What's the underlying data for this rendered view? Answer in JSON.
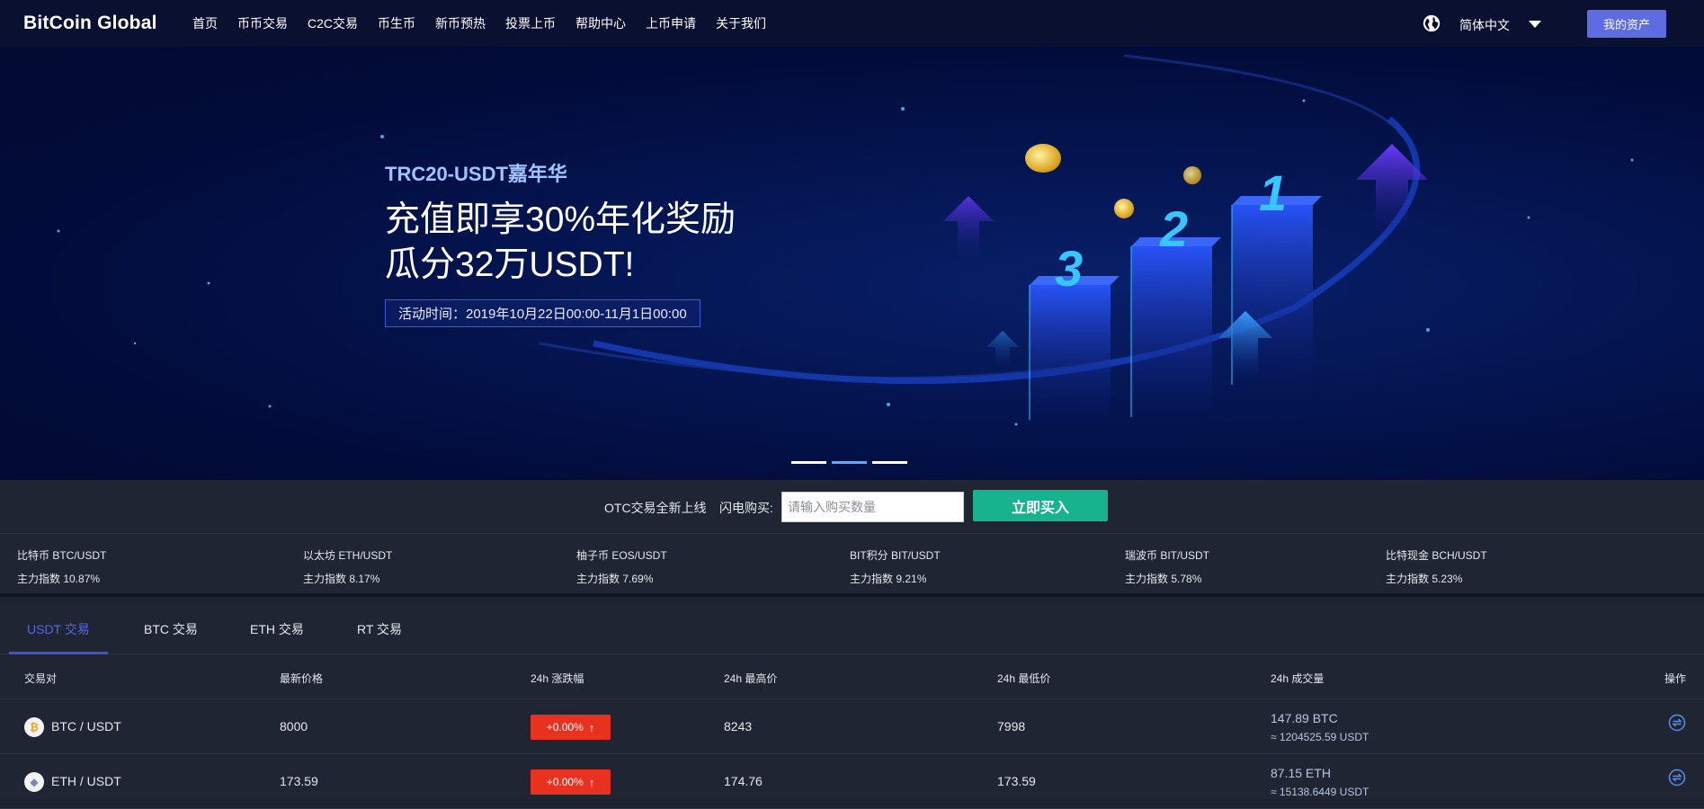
{
  "nav": {
    "logo": "BitCoin Global",
    "links": [
      "首页",
      "币币交易",
      "C2C交易",
      "币生币",
      "新币预热",
      "投票上币",
      "帮助中心",
      "上币申请",
      "关于我们"
    ],
    "language": "简体中文",
    "assets_button": "我的资产"
  },
  "banner": {
    "subtitle": "TRC20-USDT嘉年华",
    "title_line1": "充值即享30%年化奖励",
    "title_line2": "瓜分32万USDT!",
    "time": "活动时间：2019年10月22日00:00-11月1日00:00",
    "podium": [
      "1",
      "2",
      "3"
    ],
    "slides": 3,
    "active_slide": 1
  },
  "otc": {
    "announcement": "OTC交易全新上线",
    "label": "闪电购买:",
    "input_placeholder": "请输入购买数量",
    "buy_button": "立即买入"
  },
  "ticker": [
    {
      "pair": "比特币 BTC/USDT",
      "index": "主力指数 10.87%"
    },
    {
      "pair": "以太坊 ETH/USDT",
      "index": "主力指数 8.17%"
    },
    {
      "pair": "柚子币 EOS/USDT",
      "index": "主力指数 7.69%"
    },
    {
      "pair": "BIT积分 BIT/USDT",
      "index": "主力指数 9.21%"
    },
    {
      "pair": "瑞波币 BIT/USDT",
      "index": "主力指数 5.78%"
    },
    {
      "pair": "比特现金 BCH/USDT",
      "index": "主力指数 5.23%"
    }
  ],
  "market": {
    "tabs": [
      "USDT 交易",
      "BTC 交易",
      "ETH 交易",
      "RT 交易"
    ],
    "active_tab": 0,
    "columns": [
      "交易对",
      "最新价格",
      "24h 涨跌幅",
      "24h 最高价",
      "24h 最低价",
      "24h 成交量",
      "操作"
    ],
    "rows": [
      {
        "icon": "bitcoin-icon",
        "symbol": "₿",
        "pair": "BTC / USDT",
        "price": "8000",
        "change": "+0.00%",
        "high": "8243",
        "low": "7998",
        "volume": "147.89 BTC",
        "volume_usdt": "≈ 1204525.59 USDT"
      },
      {
        "icon": "ethereum-icon",
        "symbol": "◆",
        "pair": "ETH / USDT",
        "price": "173.59",
        "change": "+0.00%",
        "high": "174.76",
        "low": "173.59",
        "volume": "87.15 ETH",
        "volume_usdt": "≈ 15138.6449 USDT"
      }
    ]
  },
  "colors": {
    "nav_bg": "#0a1030",
    "accent": "#5d6ce0",
    "buy_green": "#17b38e",
    "change_red": "#e8321f",
    "panel_bg": "#1f2533"
  }
}
